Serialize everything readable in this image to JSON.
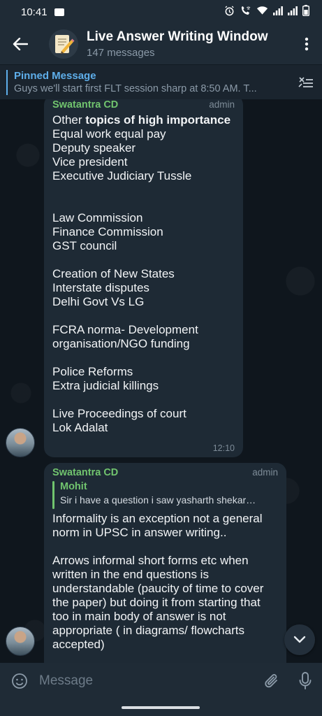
{
  "status_bar": {
    "time": "10:41",
    "icons": [
      "alarm-icon",
      "wifi-calling-icon",
      "wifi-icon",
      "signal-icon",
      "signal-icon",
      "battery-icon"
    ]
  },
  "header": {
    "title": "Live Answer Writing Window",
    "subtitle": "147 messages",
    "avatar_icon": "memo-pencil-icon",
    "back_icon": "arrow-left-icon",
    "menu_icon": "more-vertical-icon"
  },
  "pinned": {
    "label": "Pinned Message",
    "text": "Guys we'll start first FLT session sharp at 8:50 AM.   T..."
  },
  "messages": [
    {
      "sender": "Swatantra CD",
      "role": "admin",
      "text_prefix": "Other ",
      "text_bold": "topics of high importance",
      "text_body": "\nEqual work equal pay\nDeputy speaker\nVice president\nExecutive Judiciary Tussle\n\n\nLaw Commission\nFinance Commission\nGST council\n\nCreation of New States\nInterstate disputes\nDelhi Govt Vs LG\n\nFCRA norma- Development organisation/NGO funding\n\nPolice Reforms\nExtra judicial killings\n\nLive Proceedings of court\nLok Adalat",
      "time": "12:10"
    },
    {
      "sender": "Swatantra CD",
      "role": "admin",
      "reply_name": "Mohit",
      "reply_text": "Sir i have a question i saw yasharth shekar…",
      "text_body": "Informality is an exception not a general norm in UPSC in answer writing..\n\nArrows informal short forms etc when written in the end questions is understandable (paucity of time to cover the paper)  but doing it from starting that too in main body of answer is not appropriate ( in diagrams/ flowcharts accepted)"
    }
  ],
  "input": {
    "placeholder": "Message",
    "value": ""
  },
  "colors": {
    "accent": "#5eaeea",
    "sender": "#71c46e",
    "bubble": "#1e2a35",
    "header": "#1f2b36"
  }
}
